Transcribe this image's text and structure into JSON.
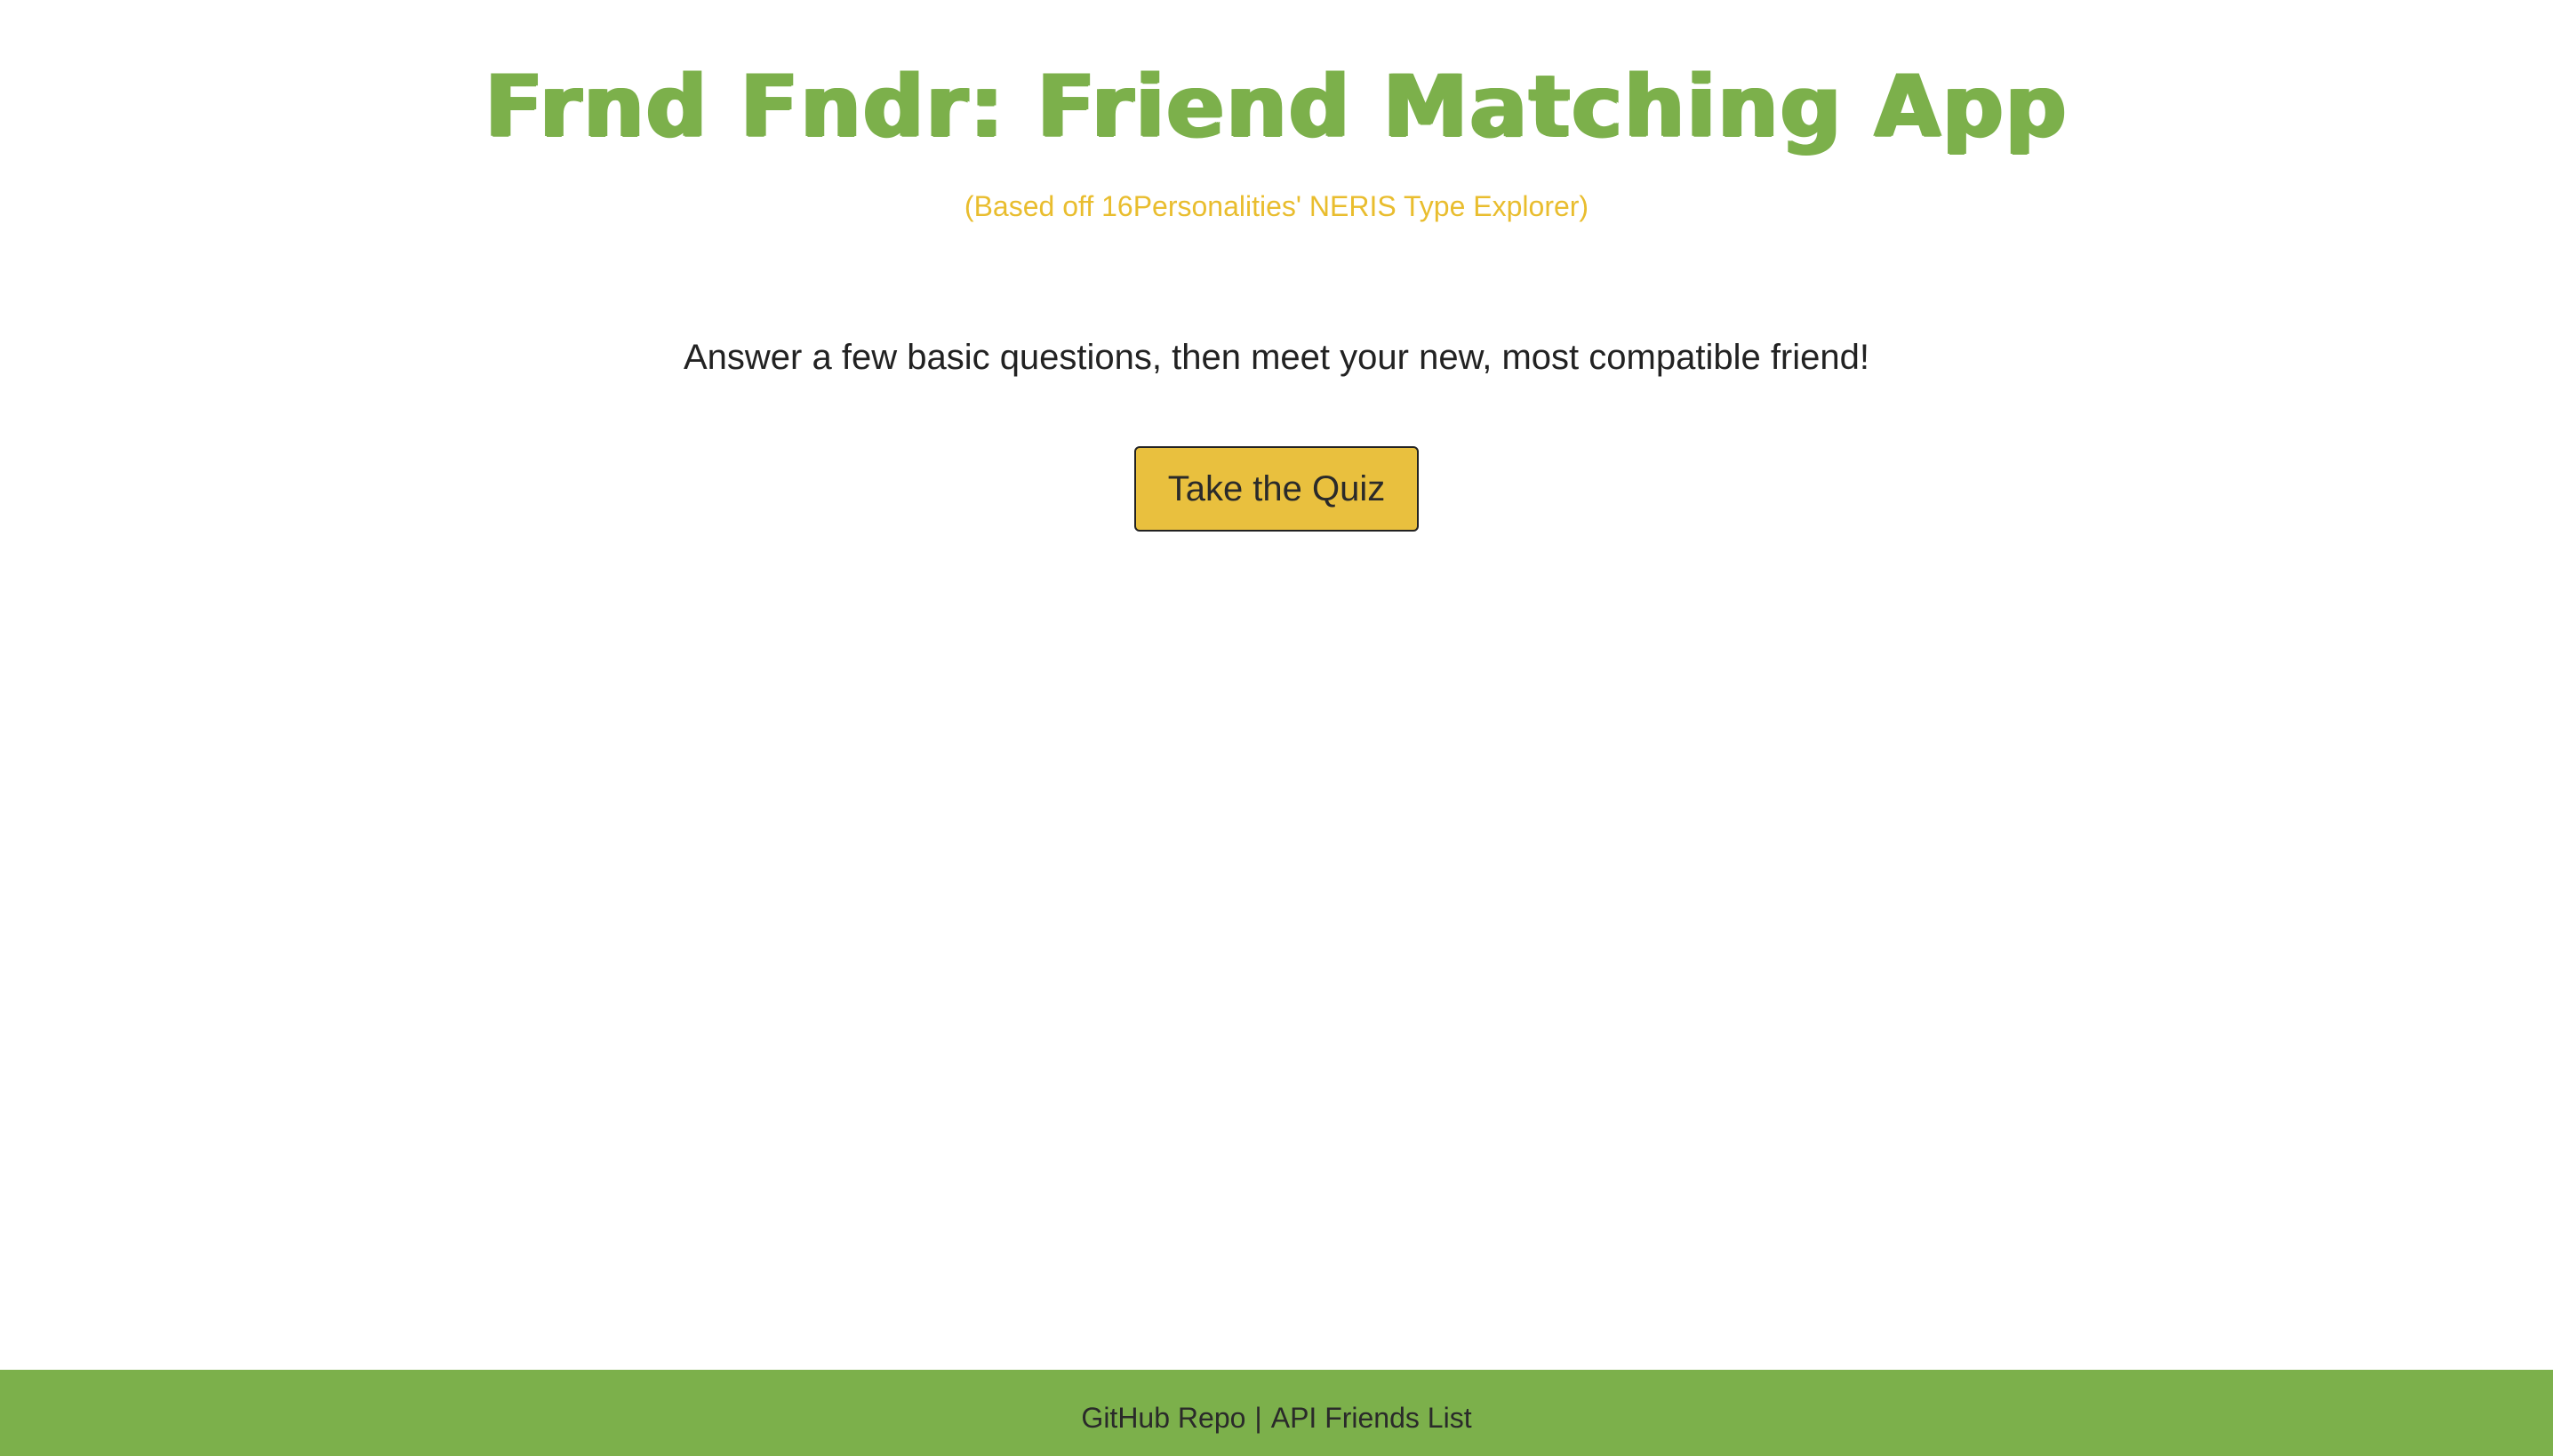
{
  "header": {
    "title": "Frnd Fndr: Friend Matching App",
    "subtitle": "(Based off 16Personalities' NERIS Type Explorer)"
  },
  "main": {
    "tagline": "Answer a few basic questions, then meet your new, most compatible friend!",
    "quiz_button_label": "Take the Quiz"
  },
  "footer": {
    "github_link": "GitHub Repo",
    "separator": "|",
    "api_link": "API Friends List"
  },
  "colors": {
    "brand_green": "#7cb04b",
    "accent_yellow": "#e9bd2e",
    "button_yellow": "#e9c03e",
    "text_dark": "#222222"
  }
}
